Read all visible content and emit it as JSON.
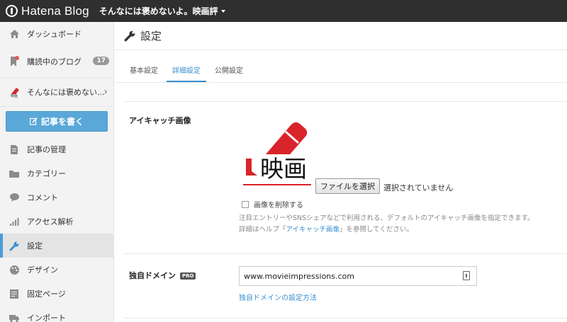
{
  "topbar": {
    "brand": "Hatena Blog",
    "blog_name": "そんなには褒めないよ。映画評"
  },
  "sidebar": {
    "items_top": [
      {
        "label": "ダッシュボード",
        "icon": "home-icon"
      },
      {
        "label": "購読中のブログ",
        "icon": "bookmark-icon",
        "count": "17"
      }
    ],
    "blog_row_label": "そんなには褒めない...",
    "write_button": "記事を書く",
    "items_bottom": [
      {
        "label": "記事の管理",
        "icon": "document-icon"
      },
      {
        "label": "カテゴリー",
        "icon": "folder-icon"
      },
      {
        "label": "コメント",
        "icon": "comment-icon"
      },
      {
        "label": "アクセス解析",
        "icon": "bar-chart-icon"
      },
      {
        "label": "設定",
        "icon": "wrench-icon",
        "active": true
      },
      {
        "label": "デザイン",
        "icon": "palette-icon"
      },
      {
        "label": "固定ページ",
        "icon": "page-icon"
      },
      {
        "label": "インポート",
        "icon": "truck-icon"
      }
    ]
  },
  "main": {
    "title": "設定",
    "tabs": [
      {
        "label": "基本設定"
      },
      {
        "label": "詳細設定",
        "active": true
      },
      {
        "label": "公開設定"
      }
    ],
    "eyecatch": {
      "label": "アイキャッチ画像",
      "image_text": "映画",
      "file_button": "ファイルを選択",
      "file_status": "選択されていません",
      "delete_label": "画像を削除する",
      "help_line1": "注目エントリーやSNSシェアなどで利用される、デフォルトのアイキャッチ画像を指定できます。",
      "help_line2_prefix": "詳細はヘルプ「",
      "help_link": "アイキャッチ画像",
      "help_line2_suffix": "」を参照してください。"
    },
    "domain": {
      "label": "独自ドメイン",
      "badge": "PRO",
      "value": "www.movieimpressions.com",
      "link": "独自ドメインの設定方法"
    }
  },
  "colors": {
    "accent": "#3a8fcf",
    "write_button": "#5aa8d8",
    "topbar": "#2f2f2f",
    "eyecatch_red": "#d8242a"
  }
}
